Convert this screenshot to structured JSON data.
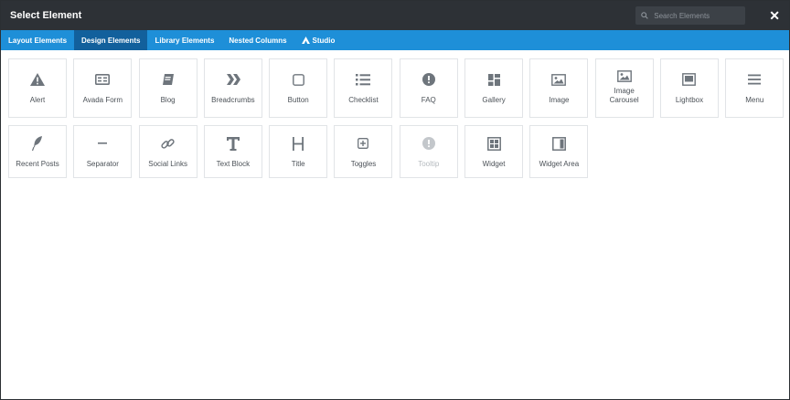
{
  "modal": {
    "title": "Select Element",
    "search_placeholder": "Search Elements",
    "close_label": "✕"
  },
  "tabs": [
    {
      "label": "Layout Elements"
    },
    {
      "label": "Design Elements"
    },
    {
      "label": "Library Elements"
    },
    {
      "label": "Nested Columns"
    },
    {
      "label": "Studio"
    }
  ],
  "active_tab": "Design Elements",
  "elements": [
    {
      "label": "Alert",
      "icon": "alert-icon"
    },
    {
      "label": "Avada Form",
      "icon": "form-icon"
    },
    {
      "label": "Blog",
      "icon": "blog-icon"
    },
    {
      "label": "Breadcrumbs",
      "icon": "breadcrumbs-icon"
    },
    {
      "label": "Button",
      "icon": "button-icon"
    },
    {
      "label": "Checklist",
      "icon": "checklist-icon"
    },
    {
      "label": "FAQ",
      "icon": "faq-icon"
    },
    {
      "label": "Gallery",
      "icon": "gallery-icon"
    },
    {
      "label": "Image",
      "icon": "image-icon"
    },
    {
      "label": "Image Carousel",
      "icon": "image-carousel-icon"
    },
    {
      "label": "Lightbox",
      "icon": "lightbox-icon"
    },
    {
      "label": "Menu",
      "icon": "menu-icon"
    },
    {
      "label": "Recent Posts",
      "icon": "recent-posts-icon"
    },
    {
      "label": "Separator",
      "icon": "separator-icon"
    },
    {
      "label": "Social Links",
      "icon": "social-links-icon"
    },
    {
      "label": "Text Block",
      "icon": "text-block-icon"
    },
    {
      "label": "Title",
      "icon": "title-icon"
    },
    {
      "label": "Toggles",
      "icon": "toggles-icon"
    },
    {
      "label": "Tooltip",
      "icon": "tooltip-icon",
      "disabled": true
    },
    {
      "label": "Widget",
      "icon": "widget-icon"
    },
    {
      "label": "Widget Area",
      "icon": "widget-area-icon"
    }
  ],
  "colors": {
    "header_bg": "#2d3136",
    "tabs_bg": "#1e8fd8",
    "active_tab_bg": "#12609c",
    "icon_color": "#6e757c",
    "disabled_icon_color": "#c3c7cb"
  }
}
